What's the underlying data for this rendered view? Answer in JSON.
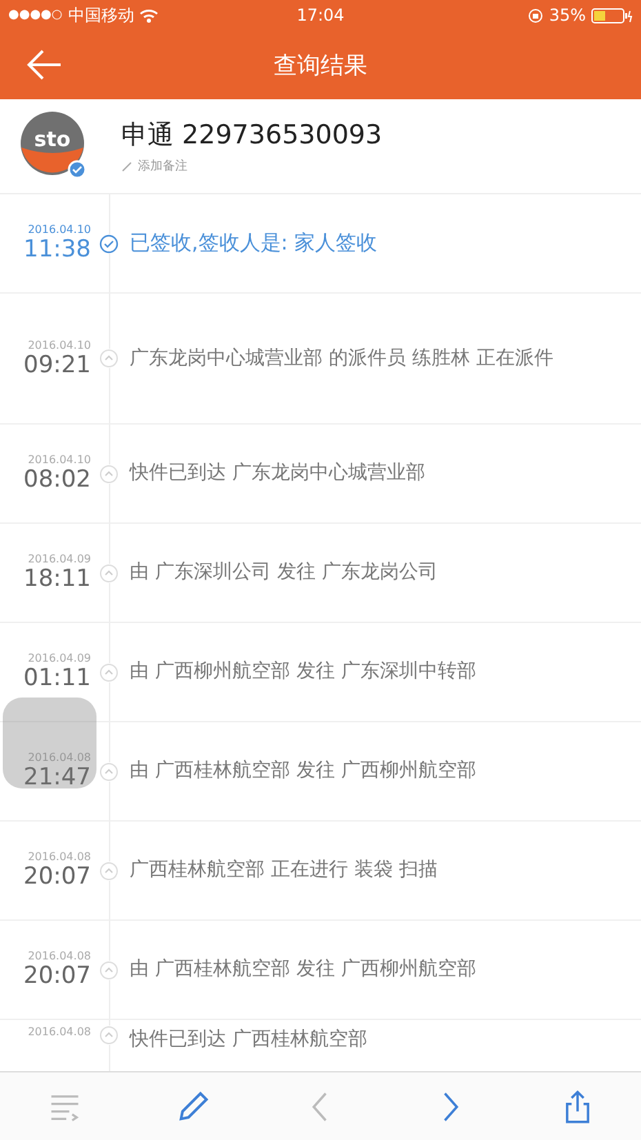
{
  "status_bar": {
    "signal": "●●●●○",
    "carrier": "中国移动",
    "time": "17:04",
    "battery": "35%"
  },
  "nav": {
    "title": "查询结果"
  },
  "package": {
    "courier_logo": "sto",
    "title": "申通 229736530093",
    "note": "添加备注"
  },
  "events": [
    {
      "kind": "signed",
      "date": "2016.04.10",
      "time": "11:38",
      "text": "已签收,签收人是: 家人签收"
    },
    {
      "kind": "transit",
      "date": "2016.04.10",
      "time": "09:21",
      "text": "广东龙岗中心城营业部 的派件员 练胜林 正在派件"
    },
    {
      "kind": "transit",
      "date": "2016.04.10",
      "time": "08:02",
      "text": "快件已到达 广东龙岗中心城营业部"
    },
    {
      "kind": "transit",
      "date": "2016.04.09",
      "time": "18:11",
      "text": "由 广东深圳公司 发往 广东龙岗公司"
    },
    {
      "kind": "transit",
      "date": "2016.04.09",
      "time": "01:11",
      "text": "由 广西柳州航空部 发往 广东深圳中转部"
    },
    {
      "kind": "transit",
      "date": "2016.04.08",
      "time": "21:47",
      "text": "由 广西桂林航空部 发往 广西柳州航空部"
    },
    {
      "kind": "transit",
      "date": "2016.04.08",
      "time": "20:07",
      "text": "广西桂林航空部 正在进行 装袋 扫描"
    },
    {
      "kind": "transit",
      "date": "2016.04.08",
      "time": "20:07",
      "text": "由 广西桂林航空部 发往 广西柳州航空部"
    },
    {
      "kind": "transit",
      "date": "2016.04.08",
      "text": "快件已到达 广西桂林航空部"
    }
  ],
  "toolbar": [
    {
      "kind": "list",
      "disabled": true
    },
    {
      "kind": "edit",
      "disabled": false
    },
    {
      "kind": "prev",
      "disabled": true
    },
    {
      "kind": "next",
      "disabled": false
    },
    {
      "kind": "share",
      "disabled": false
    }
  ]
}
